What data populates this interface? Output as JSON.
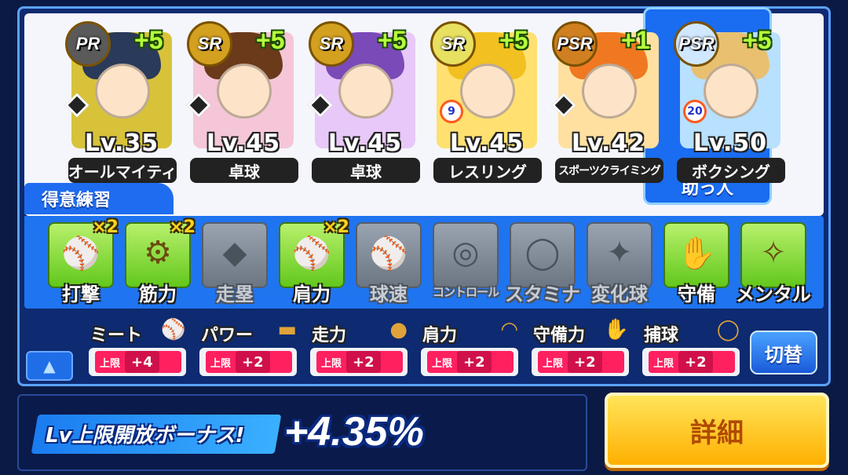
{
  "deck": {
    "cards": [
      {
        "rarity": "PR",
        "bonus": "+5",
        "level": "Lv.35",
        "name": "オールマイティ",
        "rank": "",
        "rarity_color": "#5a5a5a",
        "hair_color": "#2a3a5a",
        "bg": "#d8c23a"
      },
      {
        "rarity": "SR",
        "bonus": "+5",
        "level": "Lv.45",
        "name": "卓球",
        "rank": "",
        "rarity_color": "#d4a020",
        "hair_color": "#6a3a1a",
        "bg": "#f4c6d8"
      },
      {
        "rarity": "SR",
        "bonus": "+5",
        "level": "Lv.45",
        "name": "卓球",
        "rank": "",
        "rarity_color": "#d4a020",
        "hair_color": "#7a4ab8",
        "bg": "#e8c8f8"
      },
      {
        "rarity": "SR",
        "bonus": "+5",
        "level": "Lv.45",
        "name": "レスリング",
        "rank": "9",
        "rarity_color": "#e8e060",
        "hair_color": "#f2c020",
        "bg": "#ffe070"
      },
      {
        "rarity": "PSR",
        "bonus": "+1",
        "level": "Lv.42",
        "name": "スポーツクライミング",
        "rank": "",
        "rarity_color": "#d08020",
        "hair_color": "#f07820",
        "bg": "#ffe0a0"
      },
      {
        "rarity": "PSR",
        "bonus": "+5",
        "level": "Lv.50",
        "name": "ボクシング",
        "rank": "20",
        "rarity_color": "#d0e8ff",
        "hair_color": "#e8c070",
        "bg": "#b8e0ff"
      }
    ],
    "helper_label": "助っ人"
  },
  "practice": {
    "tab_label": "得意練習",
    "items": [
      {
        "label": "打撃",
        "mult": "×2",
        "active": true,
        "glyph": "⚾"
      },
      {
        "label": "筋力",
        "mult": "×2",
        "active": true,
        "glyph": "⚙"
      },
      {
        "label": "走塁",
        "mult": "",
        "active": false,
        "glyph": "◆"
      },
      {
        "label": "肩力",
        "mult": "×2",
        "active": true,
        "glyph": "⚾"
      },
      {
        "label": "球速",
        "mult": "",
        "active": false,
        "glyph": "⚾"
      },
      {
        "label": "コントロール",
        "mult": "",
        "active": false,
        "glyph": "◎"
      },
      {
        "label": "スタミナ",
        "mult": "",
        "active": false,
        "glyph": "◯"
      },
      {
        "label": "変化球",
        "mult": "",
        "active": false,
        "glyph": "✦"
      },
      {
        "label": "守備",
        "mult": "",
        "active": true,
        "glyph": "✋"
      },
      {
        "label": "メンタル",
        "mult": "",
        "active": true,
        "glyph": "✧"
      }
    ]
  },
  "limits": {
    "cap_label": "上限",
    "items": [
      {
        "title": "ミート",
        "value": "+4",
        "icon": "bat-icon"
      },
      {
        "title": "パワー",
        "value": "+2",
        "icon": "dumbbell-icon"
      },
      {
        "title": "走力",
        "value": "+2",
        "icon": "speed-icon"
      },
      {
        "title": "肩力",
        "value": "+2",
        "icon": "throw-icon"
      },
      {
        "title": "守備力",
        "value": "+2",
        "icon": "glove-icon"
      },
      {
        "title": "捕球",
        "value": "+2",
        "icon": "catch-icon"
      }
    ],
    "switch_label": "切替",
    "collapse_glyph": "▲"
  },
  "bonus": {
    "label": "Lv上限開放ボーナス!",
    "value": "+4.35%"
  },
  "detail_button": "詳細"
}
